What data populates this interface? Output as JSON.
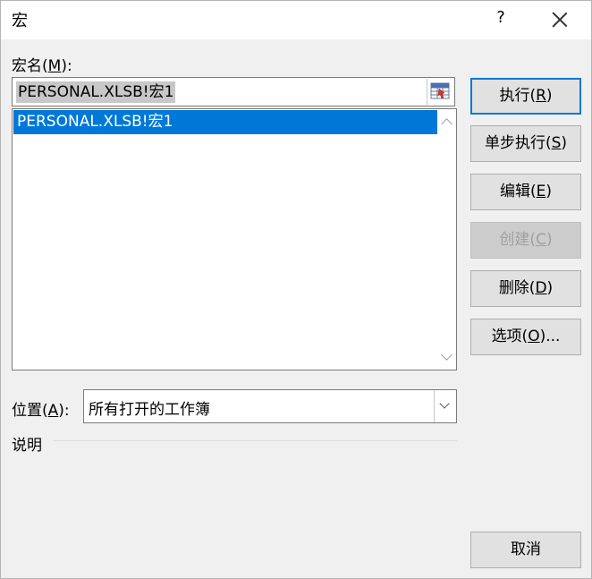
{
  "window": {
    "title": "宏",
    "help": "?"
  },
  "macro_name": {
    "label": "宏名(",
    "hotkey": "M",
    "label_end": "):",
    "value": "PERSONAL.XLSB!宏1"
  },
  "macro_list": {
    "items": [
      "PERSONAL.XLSB!宏1"
    ],
    "selected_index": 0
  },
  "buttons": {
    "run": {
      "pre": "执行(",
      "key": "R",
      "post": ")"
    },
    "step": {
      "pre": "单步执行(",
      "key": "S",
      "post": ")"
    },
    "edit": {
      "pre": "编辑(",
      "key": "E",
      "post": ")"
    },
    "create": {
      "pre": "创建(",
      "key": "C",
      "post": ")"
    },
    "delete": {
      "pre": "删除(",
      "key": "D",
      "post": ")"
    },
    "options": {
      "pre": "选项(",
      "key": "O",
      "post": ")..."
    },
    "cancel": "取消"
  },
  "location": {
    "label": "位置(",
    "hotkey": "A",
    "label_end": "):",
    "value": "所有打开的工作簿"
  },
  "description": {
    "label": "说明"
  },
  "colors": {
    "selection": "#0078d7",
    "accent_border": "#0078d7",
    "dialog_bg": "#f0f0f0"
  },
  "icons": {
    "close": "close-icon",
    "picker": "macro-picker-icon"
  }
}
